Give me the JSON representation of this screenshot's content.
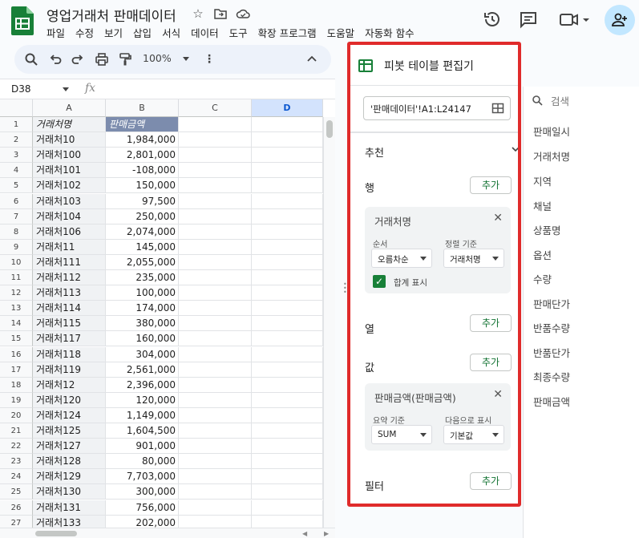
{
  "app": {
    "doc_title": "영업거래처 판매데이터",
    "menu": [
      "파일",
      "수정",
      "보기",
      "삽입",
      "서식",
      "데이터",
      "도구",
      "확장 프로그램",
      "도움말",
      "자동화 함수"
    ]
  },
  "toolbar": {
    "zoom": "100%"
  },
  "formula_bar": {
    "cell_ref": "D38",
    "fx": "fx"
  },
  "sheet": {
    "columns": [
      "A",
      "B",
      "C",
      "D"
    ],
    "header_row": {
      "a": "거래처명",
      "b": "판매금액"
    },
    "rows": [
      {
        "n": "1",
        "a": "",
        "b": ""
      },
      {
        "n": "2",
        "a": "거래처10",
        "b": "1,984,000"
      },
      {
        "n": "3",
        "a": "거래처100",
        "b": "2,801,000"
      },
      {
        "n": "4",
        "a": "거래처101",
        "b": "-108,000"
      },
      {
        "n": "5",
        "a": "거래처102",
        "b": "150,000"
      },
      {
        "n": "6",
        "a": "거래처103",
        "b": "97,500"
      },
      {
        "n": "7",
        "a": "거래처104",
        "b": "250,000"
      },
      {
        "n": "8",
        "a": "거래처106",
        "b": "2,074,000"
      },
      {
        "n": "9",
        "a": "거래처11",
        "b": "145,000"
      },
      {
        "n": "10",
        "a": "거래처111",
        "b": "2,055,000"
      },
      {
        "n": "11",
        "a": "거래처112",
        "b": "235,000"
      },
      {
        "n": "12",
        "a": "거래처113",
        "b": "100,000"
      },
      {
        "n": "13",
        "a": "거래처114",
        "b": "174,000"
      },
      {
        "n": "14",
        "a": "거래처115",
        "b": "380,000"
      },
      {
        "n": "15",
        "a": "거래처117",
        "b": "160,000"
      },
      {
        "n": "16",
        "a": "거래처118",
        "b": "304,000"
      },
      {
        "n": "17",
        "a": "거래처119",
        "b": "2,561,000"
      },
      {
        "n": "18",
        "a": "거래처12",
        "b": "2,396,000"
      },
      {
        "n": "19",
        "a": "거래처120",
        "b": "120,000"
      },
      {
        "n": "20",
        "a": "거래처124",
        "b": "1,149,000"
      },
      {
        "n": "21",
        "a": "거래처125",
        "b": "1,604,500"
      },
      {
        "n": "22",
        "a": "거래처127",
        "b": "901,000"
      },
      {
        "n": "23",
        "a": "거래처128",
        "b": "80,000"
      },
      {
        "n": "24",
        "a": "거래처129",
        "b": "7,703,000"
      },
      {
        "n": "25",
        "a": "거래처130",
        "b": "300,000"
      },
      {
        "n": "26",
        "a": "거래처131",
        "b": "756,000"
      },
      {
        "n": "27",
        "a": "거래처133",
        "b": "202,000"
      }
    ]
  },
  "pivot": {
    "title": "피봇 테이블 편집기",
    "range": "'판매데이터'!A1:L24147",
    "suggested": "추천",
    "rows_label": "행",
    "columns_label": "열",
    "values_label": "값",
    "filters_label": "필터",
    "add": "추가",
    "row_card": {
      "title": "거래처명",
      "order_label": "순서",
      "order_value": "오름차순",
      "sort_label": "정렬 기준",
      "sort_value": "거래처명",
      "show_totals": "합계 표시"
    },
    "value_card": {
      "title": "판매금액(판매금액)",
      "summarize_label": "요약 기준",
      "summarize_value": "SUM",
      "show_as_label": "다음으로 표시",
      "show_as_value": "기본값"
    }
  },
  "fields": {
    "search_placeholder": "검색",
    "items": [
      "판매일시",
      "거래처명",
      "지역",
      "채널",
      "상품명",
      "옵션",
      "수량",
      "판매단가",
      "반품수량",
      "반품단가",
      "최종수량",
      "판매금액"
    ]
  },
  "colors": {
    "accent_red": "#e02b2b",
    "header_fill": "#7c8cad",
    "sheets_green": "#188038"
  }
}
